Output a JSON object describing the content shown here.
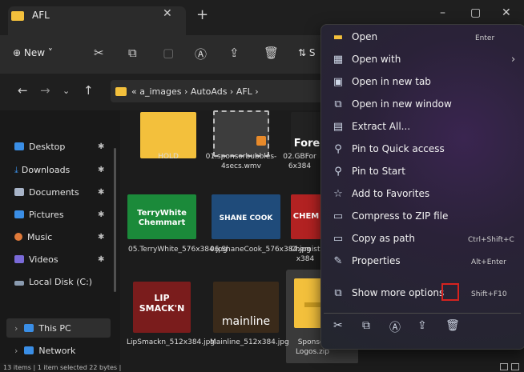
{
  "window": {
    "tab_title": "AFL",
    "tab_close": "✕",
    "tab_add": "+",
    "minimize": "–",
    "maximize": "▢",
    "close": "✕"
  },
  "toolbar": {
    "new_label": "⊕  New ˅",
    "s_label": "⇅  S"
  },
  "address": {
    "path": "« a_images  ›  AutoAds  ›  AFL  ›"
  },
  "sidebar": {
    "items": [
      {
        "label": "Desktop",
        "color": "#3a8ee6"
      },
      {
        "label": "Downloads",
        "color": "#3a8ee6"
      },
      {
        "label": "Documents",
        "color": "#a8b4c8"
      },
      {
        "label": "Pictures",
        "color": "#3a8ee6"
      },
      {
        "label": "Music",
        "color": "#e07a3a"
      },
      {
        "label": "Videos",
        "color": "#7a6ad8"
      },
      {
        "label": "Local Disk (C:)",
        "color": "#8a9bb0"
      },
      {
        "label": "This PC",
        "color": "#3a8ee6"
      },
      {
        "label": "Network",
        "color": "#3a8ee6"
      }
    ]
  },
  "files": [
    {
      "name": "HOLD",
      "color": "#f3c03c"
    },
    {
      "name": "01.sponsorbubbles-4secs.wmv",
      "color": "#3d3d3d"
    },
    {
      "name": "02.GBFor 6x384",
      "color": "#222222",
      "thumb_text": "Fore"
    },
    {
      "name": "05.TerryWhite_576x384.jpg",
      "color": "#1b8a3a",
      "thumb_text": "TerryWhite Chemmart"
    },
    {
      "name": "06.ShaneCook_576x384.jpg",
      "color": "#1f4b7a",
      "thumb_text": "SHANE COOK"
    },
    {
      "name": "Chemist x384",
      "color": "#b22222",
      "thumb_text": "CHEM"
    },
    {
      "name": "LipSmackn_512x384.jpg",
      "color": "#7a1c1c",
      "thumb_text": "LIP SMACK'N"
    },
    {
      "name": "Mainline_512x384.jpg",
      "color": "#3a2a1a",
      "thumb_text": "mainline"
    },
    {
      "name": "Sponsor Logos.zip",
      "color": "#f3c03c"
    }
  ],
  "status": {
    "text": "13 items  |  1 item selected  22 bytes  |"
  },
  "menu": {
    "items": [
      {
        "label": "Open",
        "shortcut": "Enter",
        "icon": "folder-open-icon",
        "glyph": "▬"
      },
      {
        "label": "Open with",
        "shortcut": "›",
        "icon": "open-with-icon",
        "glyph": "▦"
      },
      {
        "label": "Open in new tab",
        "shortcut": "",
        "icon": "new-tab-icon",
        "glyph": "▣"
      },
      {
        "label": "Open in new window",
        "shortcut": "",
        "icon": "new-window-icon",
        "glyph": "⧉"
      },
      {
        "label": "Extract All...",
        "shortcut": "",
        "icon": "extract-icon",
        "glyph": "▤"
      },
      {
        "label": "Pin to Quick access",
        "shortcut": "",
        "icon": "pin-icon",
        "glyph": "⚲"
      },
      {
        "label": "Pin to Start",
        "shortcut": "",
        "icon": "pin-start-icon",
        "glyph": "⚲"
      },
      {
        "label": "Add to Favorites",
        "shortcut": "",
        "icon": "star-icon",
        "glyph": "☆"
      },
      {
        "label": "Compress to ZIP file",
        "shortcut": "",
        "icon": "zip-icon",
        "glyph": "▭"
      },
      {
        "label": "Copy as path",
        "shortcut": "Ctrl+Shift+C",
        "icon": "copy-path-icon",
        "glyph": "▭"
      },
      {
        "label": "Properties",
        "shortcut": "Alt+Enter",
        "icon": "wrench-icon",
        "glyph": "✎"
      },
      {
        "label": "Show more options",
        "shortcut": "Shift+F10",
        "icon": "more-options-icon",
        "glyph": "⧉"
      }
    ],
    "bottom_icons": [
      "✂",
      "⧉",
      "Ⓐ",
      "⇪",
      "🗑"
    ]
  }
}
